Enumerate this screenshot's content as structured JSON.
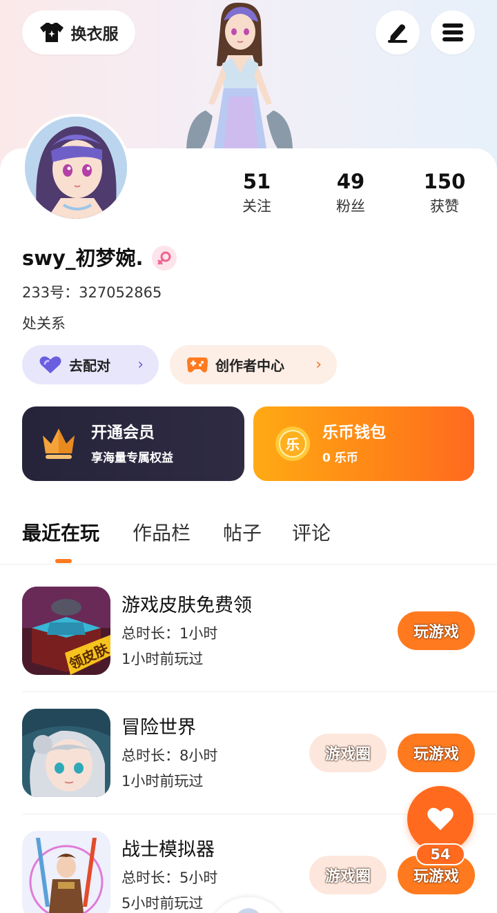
{
  "header": {
    "dress_label": "换衣服",
    "icons": [
      "shirt-icon",
      "pen-icon",
      "menu-icon"
    ]
  },
  "profile": {
    "stats": [
      {
        "value": "51",
        "label": "关注"
      },
      {
        "value": "49",
        "label": "粉丝"
      },
      {
        "value": "150",
        "label": "获赞"
      }
    ],
    "nickname": "swy_初梦婉.",
    "gender": "female",
    "uid_label": "233号：",
    "uid_value": "327052865",
    "bio": "处关系"
  },
  "chips": {
    "match_label": "去配对",
    "creator_label": "创作者中心"
  },
  "promos": {
    "vip": {
      "title": "开通会员",
      "subtitle": "享海量专属权益"
    },
    "wallet": {
      "title": "乐币钱包",
      "subtitle": "0 乐币",
      "coin_char": "乐"
    }
  },
  "tabs": [
    "最近在玩",
    "作品栏",
    "帖子",
    "评论"
  ],
  "games": [
    {
      "name": "游戏皮肤免费领",
      "duration": "总时长：1小时",
      "last_played": "1小时前玩过",
      "has_circle": false,
      "play_label": "玩游戏",
      "badge_text": "领皮肤"
    },
    {
      "name": "冒险世界",
      "duration": "总时长：8小时",
      "last_played": "1小时前玩过",
      "has_circle": true,
      "circle_label": "游戏圈",
      "play_label": "玩游戏"
    },
    {
      "name": "战士模拟器",
      "duration": "总时长：5小时",
      "last_played": "5小时前玩过",
      "has_circle": true,
      "circle_label": "游戏圈",
      "play_label": "玩游戏"
    }
  ],
  "fab": {
    "count": "54"
  },
  "colors": {
    "accent": "#ff7a1f",
    "match_bg": "#e8e6fb",
    "creator_bg": "#fdeee6",
    "vip_bg": "#26243a"
  }
}
